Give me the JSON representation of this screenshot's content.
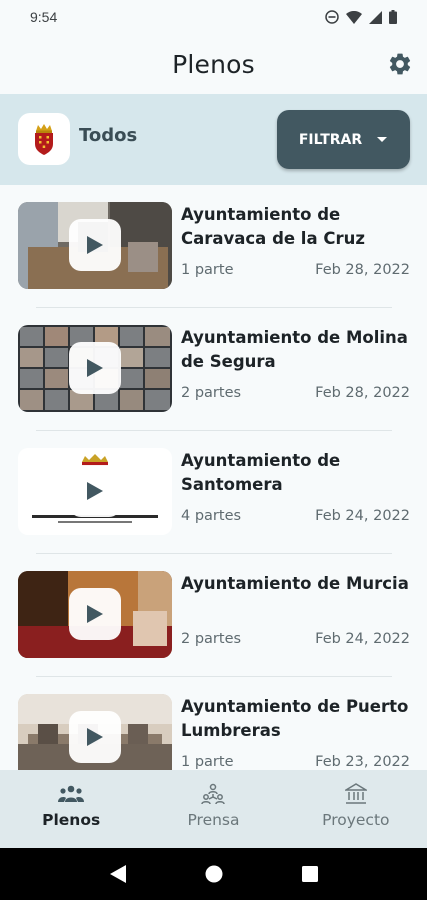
{
  "status_bar": {
    "time": "9:54"
  },
  "app_bar": {
    "title": "Plenos",
    "settings_icon": "gear-icon"
  },
  "filter_bar": {
    "region_label": "Todos",
    "filter_label": "FILTRAR",
    "dropdown_icon": "caret-down-icon"
  },
  "plenos": [
    {
      "title": "Ayuntamiento de Caravaca de la Cruz",
      "parts": "1 parte",
      "date": "Feb 28, 2022"
    },
    {
      "title": "Ayuntamiento de Molina de Segura",
      "parts": "2 partes",
      "date": "Feb 28, 2022"
    },
    {
      "title": "Ayuntamiento de Santomera",
      "parts": "4 partes",
      "date": "Feb 24, 2022"
    },
    {
      "title": "Ayuntamiento de Murcia",
      "parts": "2 partes",
      "date": "Feb 24, 2022"
    },
    {
      "title": "Ayuntamiento de Puerto Lumbreras",
      "parts": "1 parte",
      "date": "Feb 23, 2022"
    }
  ],
  "bottom_nav": {
    "items": [
      {
        "label": "Plenos",
        "icon": "people-icon",
        "active": true
      },
      {
        "label": "Prensa",
        "icon": "press-icon",
        "active": false
      },
      {
        "label": "Proyecto",
        "icon": "institution-icon",
        "active": false
      }
    ]
  },
  "colors": {
    "filter_band": "#d6e7ec",
    "filter_button": "#425861",
    "bottom_nav": "#dfe9ec"
  }
}
